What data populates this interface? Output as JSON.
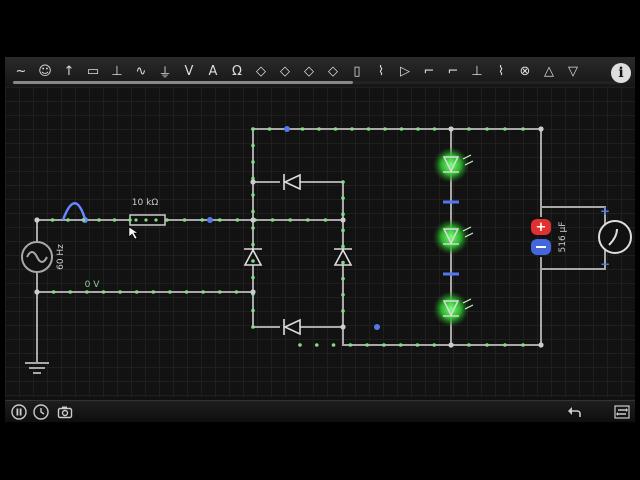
{
  "toolbar": {
    "tools": [
      {
        "name": "ac-source-tool-icon"
      },
      {
        "name": "meter-tool-icon"
      },
      {
        "name": "dc-source-tool-icon"
      },
      {
        "name": "resistor-tool-icon"
      },
      {
        "name": "capacitor-tool-icon"
      },
      {
        "name": "inductor-tool-icon"
      },
      {
        "name": "ground-tool-icon"
      },
      {
        "name": "voltmeter-tool-icon"
      },
      {
        "name": "ammeter-tool-icon"
      },
      {
        "name": "ohmmeter-tool-icon"
      },
      {
        "name": "diode-tool-icon"
      },
      {
        "name": "zener-tool-icon"
      },
      {
        "name": "led-tool-icon"
      },
      {
        "name": "transistor-tool-icon"
      },
      {
        "name": "fuse-tool-icon"
      },
      {
        "name": "transformer-tool-icon"
      },
      {
        "name": "opamp-tool-icon"
      },
      {
        "name": "switch-tool-icon"
      },
      {
        "name": "switch-2-tool-icon"
      },
      {
        "name": "pushbutton-tool-icon"
      },
      {
        "name": "relay-tool-icon"
      },
      {
        "name": "lamp-tool-icon"
      },
      {
        "name": "spark-gap-tool-icon"
      },
      {
        "name": "triangle-tool-icon"
      }
    ],
    "info_label": "i"
  },
  "circuit": {
    "resistor_label": "10 kΩ",
    "source_freq_label": "60 Hz",
    "node_voltage_label": "0 V",
    "capacitor_label": "516 µF",
    "meter_plus": "+",
    "meter_minus": "−"
  },
  "colors": {
    "wire": "#a8a8a8",
    "current_dot": "#7fe07f",
    "charge_blue": "#5577ee",
    "led_glow": "#3fe03f",
    "cap_plus": "#e03030",
    "cap_minus": "#4466dd",
    "trace": "#6688ff"
  }
}
